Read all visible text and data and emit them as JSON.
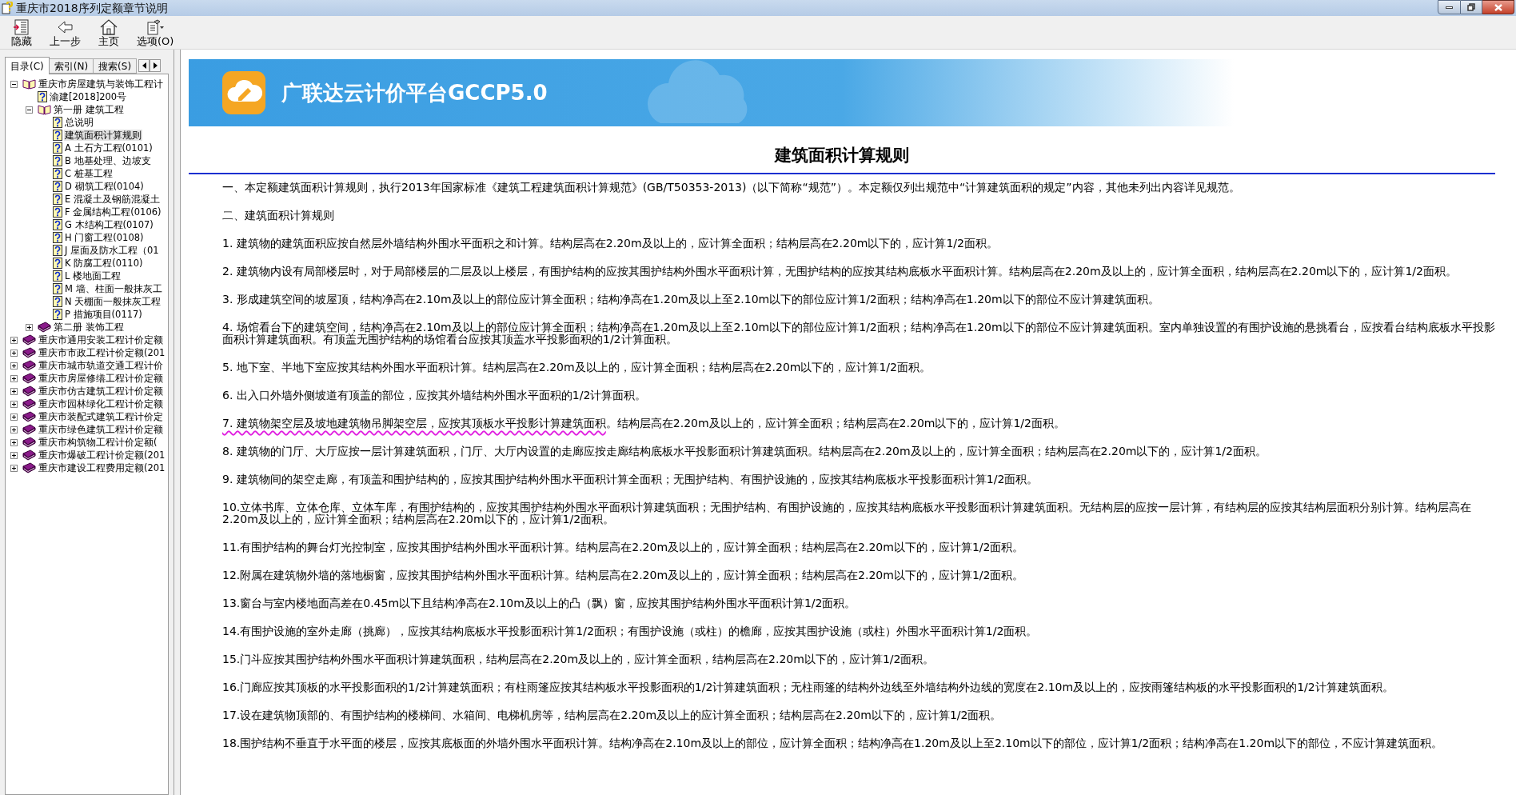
{
  "window": {
    "title": "重庆市2018序列定额章节说明"
  },
  "toolbar": [
    {
      "kind": "hide",
      "label": "隐藏"
    },
    {
      "kind": "back",
      "label": "上一步"
    },
    {
      "kind": "home",
      "label": "主页"
    },
    {
      "kind": "options",
      "label": "选项(O)"
    }
  ],
  "tabs": [
    {
      "label": "目录(C)",
      "selected": true
    },
    {
      "label": "索引(N)",
      "selected": false
    },
    {
      "label": "搜索(S)",
      "selected": false
    }
  ],
  "tree": [
    {
      "kind": "book",
      "label": "重庆市房屋建筑与装饰工程计",
      "expanded": true,
      "selected": false,
      "children": [
        {
          "kind": "page",
          "label": "渝建[2018]200号",
          "selected": false
        },
        {
          "kind": "book",
          "label": "第一册 建筑工程",
          "expanded": true,
          "selected": false,
          "children": [
            {
              "kind": "page",
              "label": "总说明",
              "selected": false
            },
            {
              "kind": "page",
              "label": "建筑面积计算规则",
              "selected": true
            },
            {
              "kind": "page",
              "label": "A 土石方工程(0101)",
              "selected": false
            },
            {
              "kind": "page",
              "label": "B 地基处理、边坡支",
              "selected": false
            },
            {
              "kind": "page",
              "label": "C 桩基工程",
              "selected": false
            },
            {
              "kind": "page",
              "label": "D 砌筑工程(0104)",
              "selected": false
            },
            {
              "kind": "page",
              "label": "E 混凝土及钢筋混凝土",
              "selected": false
            },
            {
              "kind": "page",
              "label": "F 金属结构工程(0106)",
              "selected": false
            },
            {
              "kind": "page",
              "label": "G 木结构工程(0107)",
              "selected": false
            },
            {
              "kind": "page",
              "label": "H 门窗工程(0108)",
              "selected": false
            },
            {
              "kind": "page",
              "label": "J 屋面及防水工程（01",
              "selected": false
            },
            {
              "kind": "page",
              "label": "K 防腐工程(0110)",
              "selected": false
            },
            {
              "kind": "page",
              "label": "L 楼地面工程",
              "selected": false
            },
            {
              "kind": "page",
              "label": "M 墙、柱面一般抹灰工",
              "selected": false
            },
            {
              "kind": "page",
              "label": "N 天棚面一般抹灰工程",
              "selected": false
            },
            {
              "kind": "page",
              "label": "P 措施项目(0117)",
              "selected": false
            }
          ]
        },
        {
          "kind": "book",
          "label": "第二册 装饰工程",
          "expanded": false,
          "selected": false
        }
      ]
    },
    {
      "kind": "book",
      "label": "重庆市通用安装工程计价定额",
      "expanded": false,
      "selected": false
    },
    {
      "kind": "book",
      "label": "重庆市市政工程计价定额(201",
      "expanded": false,
      "selected": false
    },
    {
      "kind": "book",
      "label": "重庆市城市轨道交通工程计价",
      "expanded": false,
      "selected": false
    },
    {
      "kind": "book",
      "label": "重庆市房屋修缮工程计价定额",
      "expanded": false,
      "selected": false
    },
    {
      "kind": "book",
      "label": "重庆市仿古建筑工程计价定额",
      "expanded": false,
      "selected": false
    },
    {
      "kind": "book",
      "label": "重庆市园林绿化工程计价定额",
      "expanded": false,
      "selected": false
    },
    {
      "kind": "book",
      "label": "重庆市装配式建筑工程计价定",
      "expanded": false,
      "selected": false
    },
    {
      "kind": "book",
      "label": "重庆市绿色建筑工程计价定额",
      "expanded": false,
      "selected": false
    },
    {
      "kind": "book",
      "label": "重庆市构筑物工程计价定额(",
      "expanded": false,
      "selected": false
    },
    {
      "kind": "book",
      "label": "重庆市爆破工程计价定额(201",
      "expanded": false,
      "selected": false
    },
    {
      "kind": "book",
      "label": "重庆市建设工程费用定额(201",
      "expanded": false,
      "selected": false
    }
  ],
  "banner": {
    "title": "广联达云计价平台GCCP5.0"
  },
  "article": {
    "heading": "建筑面积计算规则",
    "paragraphs": [
      {
        "text": "一、本定额建筑面积计算规则，执行2013年国家标准《建筑工程建筑面积计算规范》(GB/T50353-2013)（以下简称“规范”）。本定额仅列出规范中“计算建筑面积的规定”内容，其他未列出内容详见规范。"
      },
      {
        "text": "二、建筑面积计算规则"
      },
      {
        "text": "1. 建筑物的建筑面积应按自然层外墙结构外围水平面积之和计算。结构层高在2.20m及以上的，应计算全面积；结构层高在2.20m以下的，应计算1/2面积。"
      },
      {
        "text": "2. 建筑物内设有局部楼层时，对于局部楼层的二层及以上楼层，有围护结构的应按其围护结构外围水平面积计算，无围护结构的应按其结构底板水平面积计算。结构层高在2.20m及以上的，应计算全面积，结构层高在2.20m以下的，应计算1/2面积。"
      },
      {
        "text": "3. 形成建筑空间的坡屋顶，结构净高在2.10m及以上的部位应计算全面积；结构净高在1.20m及以上至2.10m以下的部位应计算1/2面积；结构净高在1.20m以下的部位不应计算建筑面积。"
      },
      {
        "text": "4. 场馆看台下的建筑空间，结构净高在2.10m及以上的部位应计算全面积；结构净高在1.20m及以上至2.10m以下的部位应计算1/2面积；结构净高在1.20m以下的部位不应计算建筑面积。室内单独设置的有围护设施的悬挑看台，应按看台结构底板水平投影面积计算建筑面积。有顶盖无围护结构的场馆看台应按其顶盖水平投影面积的1/2计算面积。"
      },
      {
        "text": "5. 地下室、半地下室应按其结构外围水平面积计算。结构层高在2.20m及以上的，应计算全面积；结构层高在2.20m以下的，应计算1/2面积。"
      },
      {
        "text": "6. 出入口外墙外侧坡道有顶盖的部位，应按其外墙结构外围水平面积的1/2计算面积。"
      },
      {
        "marked": "7. 建筑物架空层及坡地建筑物吊脚架空层，应按其顶板水平投影计算建筑面积",
        "text": "。结构层高在2.20m及以上的，应计算全面积；结构层高在2.20m以下的，应计算1/2面积。"
      },
      {
        "text": "8. 建筑物的门厅、大厅应按一层计算建筑面积，门厅、大厅内设置的走廊应按走廊结构底板水平投影面积计算建筑面积。结构层高在2.20m及以上的，应计算全面积；结构层高在2.20m以下的，应计算1/2面积。"
      },
      {
        "text": "9. 建筑物间的架空走廊，有顶盖和围护结构的，应按其围护结构外围水平面积计算全面积；无围护结构、有围护设施的，应按其结构底板水平投影面积计算1/2面积。"
      },
      {
        "text": "10.立体书库、立体仓库、立体车库，有围护结构的，应按其围护结构外围水平面积计算建筑面积；无围护结构、有围护设施的，应按其结构底板水平投影面积计算建筑面积。无结构层的应按一层计算，有结构层的应按其结构层面积分别计算。结构层高在2.20m及以上的，应计算全面积；结构层高在2.20m以下的，应计算1/2面积。"
      },
      {
        "text": "11.有围护结构的舞台灯光控制室，应按其围护结构外围水平面积计算。结构层高在2.20m及以上的，应计算全面积；结构层高在2.20m以下的，应计算1/2面积。"
      },
      {
        "text": "12.附属在建筑物外墙的落地橱窗，应按其围护结构外围水平面积计算。结构层高在2.20m及以上的，应计算全面积；结构层高在2.20m以下的，应计算1/2面积。"
      },
      {
        "text": "13.窗台与室内楼地面高差在0.45m以下且结构净高在2.10m及以上的凸（飘）窗，应按其围护结构外围水平面积计算1/2面积。"
      },
      {
        "text": "14.有围护设施的室外走廊（挑廊），应按其结构底板水平投影面积计算1/2面积；有围护设施（或柱）的檐廊，应按其围护设施（或柱）外围水平面积计算1/2面积。"
      },
      {
        "text": "15.门斗应按其围护结构外围水平面积计算建筑面积，结构层高在2.20m及以上的，应计算全面积，结构层高在2.20m以下的，应计算1/2面积。"
      },
      {
        "text": "16.门廊应按其顶板的水平投影面积的1/2计算建筑面积；有柱雨篷应按其结构板水平投影面积的1/2计算建筑面积；无柱雨篷的结构外边线至外墙结构外边线的宽度在2.10m及以上的，应按雨篷结构板的水平投影面积的1/2计算建筑面积。"
      },
      {
        "text": "17.设在建筑物顶部的、有围护结构的楼梯间、水箱间、电梯机房等，结构层高在2.20m及以上的应计算全面积；结构层高在2.20m以下的，应计算1/2面积。"
      },
      {
        "text": "18.围护结构不垂直于水平面的楼层，应按其底板面的外墙外围水平面积计算。结构净高在2.10m及以上的部位，应计算全面积；结构净高在1.20m及以上至2.10m以下的部位，应计算1/2面积；结构净高在1.20m以下的部位，不应计算建筑面积。"
      }
    ]
  }
}
